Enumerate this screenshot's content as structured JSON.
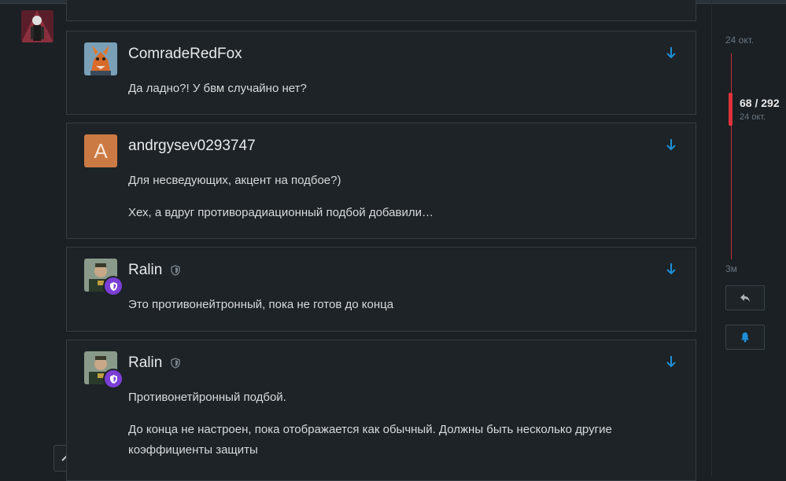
{
  "posts": [
    {
      "username": "ComradeRedFox",
      "paragraphs": [
        "Да ладно?! У бвм случайно нет?"
      ]
    },
    {
      "username": "andrgysev0293747",
      "avatar_letter": "A",
      "paragraphs": [
        "Для несведующих, акцент на подбое?)",
        "Хех, а вдруг противорадиационный подбой добавили…"
      ]
    },
    {
      "username": "Ralin",
      "paragraphs": [
        "Это противонейтронный, пока не готов до конца"
      ]
    },
    {
      "username": "Ralin",
      "paragraphs": [
        "Противонетйронный подбой.",
        "До конца не настроен, пока отображается как обычный. Должны быть несколько другие коэффициенты защиты"
      ]
    }
  ],
  "timeline": {
    "top_date": "24 окт.",
    "position": "68 / 292",
    "position_date": "24 окт.",
    "bottom_label": "3м",
    "progress": 0.23
  },
  "colors": {
    "accent_blue": "#1f8fd6",
    "timeline_red": "#e0323c",
    "moderator_purple": "#7b3fd6"
  },
  "icons": {
    "reply": "reply-icon",
    "bell": "bell-icon",
    "scroll_top": "chevron-up-icon",
    "down_arrow": "arrow-down-icon",
    "shield": "shield-icon"
  }
}
